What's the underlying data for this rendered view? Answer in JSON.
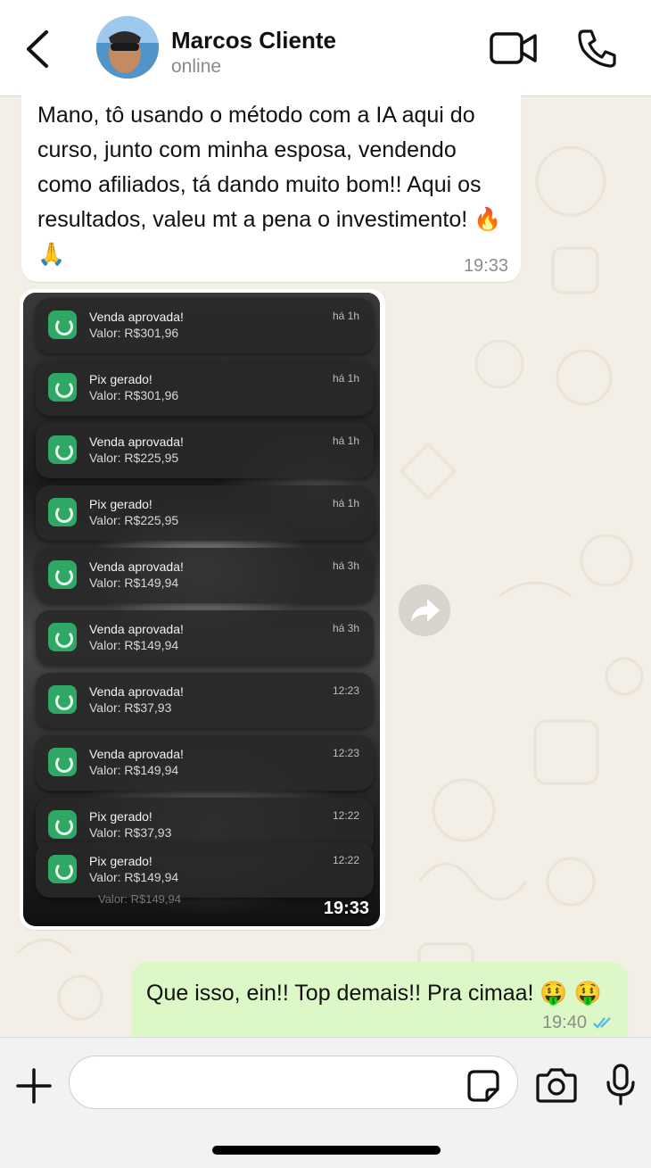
{
  "header": {
    "contact_name": "Marcos Cliente",
    "contact_status": "online"
  },
  "messages": {
    "incoming_text": "Mano, tô usando o método com a IA aqui do curso, junto com minha esposa, vendendo como afiliados, tá dando muito bom!! Aqui os resultados, valeu mt a pena o investimento! 🔥 🙏",
    "incoming_time": "19:33",
    "image_time": "19:33",
    "outgoing_text": "Que isso, ein!! Top demais!! Pra cimaa! 🤑 🤑",
    "outgoing_time": "19:40"
  },
  "notifications": [
    {
      "title": "Venda aprovada!",
      "value": "Valor: R$301,96",
      "time": "há 1h"
    },
    {
      "title": "Pix gerado!",
      "value": "Valor: R$301,96",
      "time": "há 1h"
    },
    {
      "title": "Venda aprovada!",
      "value": "Valor: R$225,95",
      "time": "há 1h"
    },
    {
      "title": "Pix gerado!",
      "value": "Valor: R$225,95",
      "time": "há 1h"
    },
    {
      "title": "Venda aprovada!",
      "value": "Valor: R$149,94",
      "time": "há 3h"
    },
    {
      "title": "Venda aprovada!",
      "value": "Valor: R$149,94",
      "time": "há 3h"
    },
    {
      "title": "Venda aprovada!",
      "value": "Valor: R$37,93",
      "time": "12:23"
    },
    {
      "title": "Venda aprovada!",
      "value": "Valor: R$149,94",
      "time": "12:23"
    },
    {
      "title": "Pix gerado!",
      "value": "Valor: R$37,93",
      "time": "12:22"
    },
    {
      "title": "Pix gerado!",
      "value": "Valor: R$149,94",
      "time": "12:22"
    }
  ],
  "ghost_value": "Valor: R$149,94",
  "input": {
    "placeholder": ""
  },
  "colors": {
    "outgoing_bubble": "#dcf8c6",
    "app_icon": "#2fa866",
    "read_ticks": "#53bdeb"
  }
}
